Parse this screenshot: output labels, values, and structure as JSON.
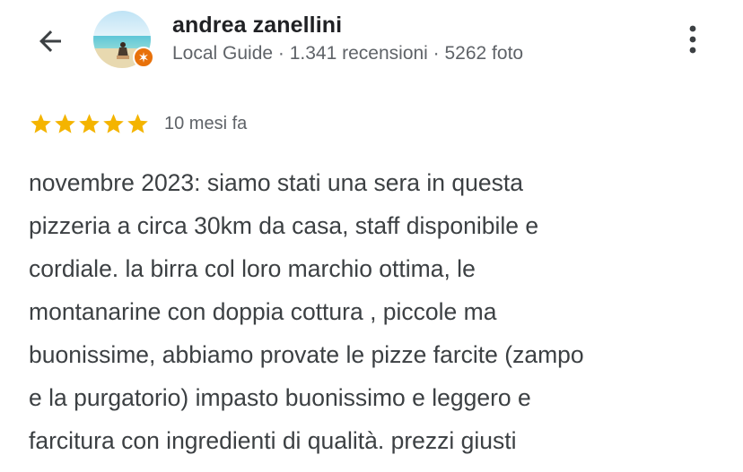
{
  "header": {
    "back_icon": "arrow-back-icon",
    "more_icon": "more-vert-icon"
  },
  "reviewer": {
    "name": "andrea zanellini",
    "meta": "Local Guide · 1.341 recensioni · 5262 foto",
    "avatar_icon": "avatar-beach-photo",
    "badge_icon": "local-guide-star-icon",
    "badge_color": "#e8710a"
  },
  "review": {
    "rating": 5,
    "max_rating": 5,
    "star_color": "#f4b400",
    "date": "10 mesi fa",
    "text_lines": [
      "novembre 2023: siamo stati una sera in questa",
      "pizzeria a circa 30km da casa, staff disponibile e",
      "cordiale. la birra col loro marchio ottima, le",
      "montanarine con doppia cottura , piccole ma",
      "buonissime, abbiamo provate le pizze farcite (zampo",
      "e la purgatorio) impasto buonissimo e leggero e",
      "farcitura con ingredienti di qualità. prezzi giusti"
    ]
  }
}
